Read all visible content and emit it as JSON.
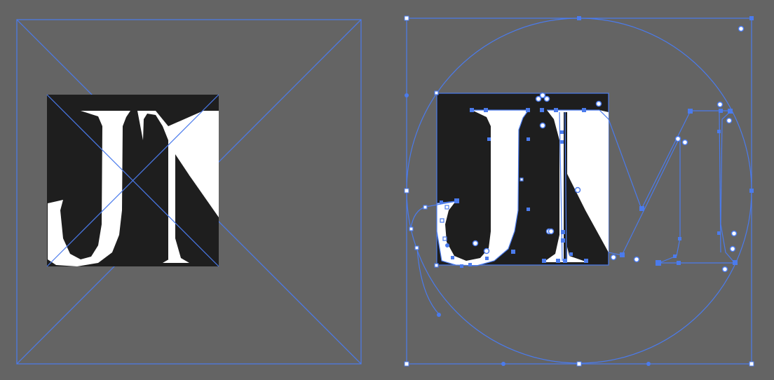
{
  "document": {
    "background_color": "#646464",
    "selection_color": "#4b7bec",
    "tile_dark_color": "#1e1e1e",
    "glyph_color": "#ffffff"
  },
  "artboard_left": {
    "label": "",
    "placeholder_frame": true,
    "content": "embedded-image",
    "icon": "image-placeholder-icon"
  },
  "artboard_right": {
    "label": "",
    "content": "vector-glyph-outline",
    "icon": "anchor-point-icon"
  }
}
